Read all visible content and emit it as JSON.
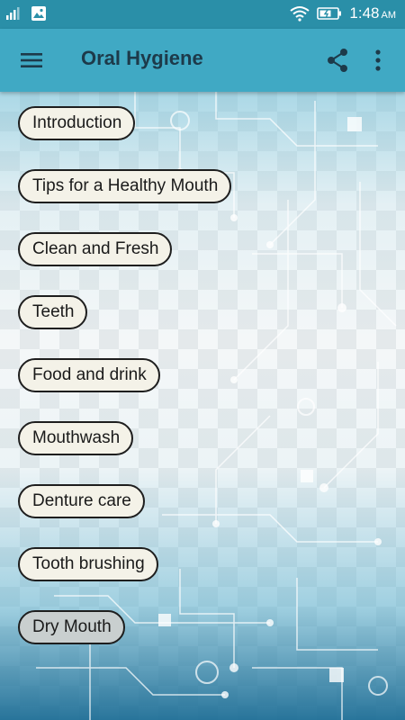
{
  "status_bar": {
    "time": "1:48",
    "ampm": "AM",
    "icons": [
      "signal-icon",
      "image-notification-icon",
      "wifi-icon",
      "battery-icon"
    ]
  },
  "app_bar": {
    "title": "Oral Hygiene",
    "icons": [
      "menu-icon",
      "share-icon",
      "more-vert-icon"
    ]
  },
  "colors": {
    "status_bar": "#2a8fa8",
    "app_bar": "#40a9c4",
    "title_text": "#1d3a4a",
    "pill_background": "#f4f2e8",
    "pill_pressed_background": "#c9cfcf",
    "pill_border": "#1e1e1e"
  },
  "topics": [
    {
      "label": "Introduction"
    },
    {
      "label": "Tips for a Healthy Mouth"
    },
    {
      "label": "Clean and Fresh"
    },
    {
      "label": "Teeth"
    },
    {
      "label": "Food and drink"
    },
    {
      "label": "Mouthwash"
    },
    {
      "label": "Denture care"
    },
    {
      "label": "Tooth brushing"
    },
    {
      "label": "Dry Mouth",
      "pressed": true
    }
  ]
}
